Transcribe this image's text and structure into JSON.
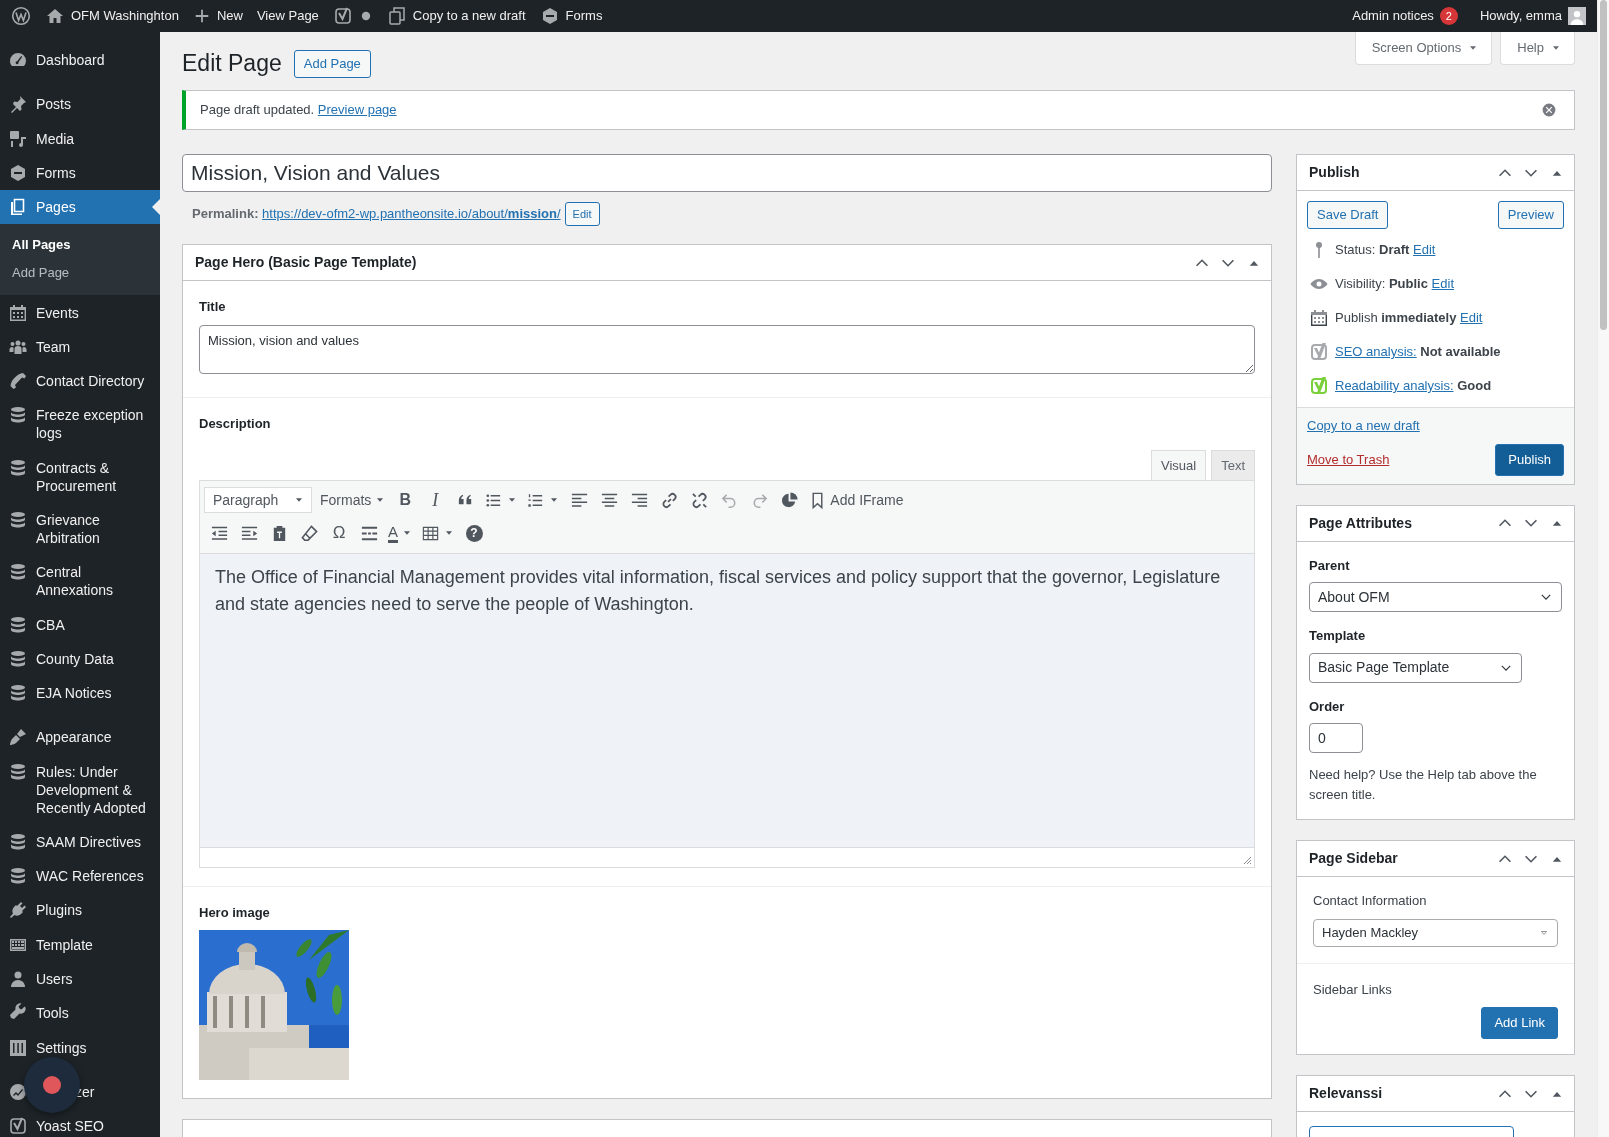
{
  "admin_bar": {
    "site": "OFM Washinghton",
    "new": "New",
    "view": "View Page",
    "copy": "Copy to a new draft",
    "forms": "Forms",
    "notices": "Admin notices",
    "notice_count": "2",
    "greeting": "Howdy, emma"
  },
  "sidebar": {
    "items": [
      {
        "kind": "menu",
        "label": "Dashboard",
        "selected": false
      },
      {
        "kind": "separator"
      },
      {
        "kind": "menu",
        "label": "Posts",
        "selected": false
      },
      {
        "kind": "menu",
        "label": "Media",
        "selected": false
      },
      {
        "kind": "menu",
        "label": "Forms",
        "selected": false
      },
      {
        "kind": "menu",
        "label": "Pages",
        "selected": true,
        "children": [
          {
            "label": "All Pages",
            "selected": true
          },
          {
            "label": "Add Page",
            "selected": false
          }
        ]
      },
      {
        "kind": "menu",
        "label": "Events",
        "selected": false
      },
      {
        "kind": "menu",
        "label": "Team",
        "selected": false
      },
      {
        "kind": "menu",
        "label": "Contact Directory",
        "selected": false
      },
      {
        "kind": "menu",
        "label": "Freeze exception logs",
        "selected": false
      },
      {
        "kind": "menu",
        "label": "Contracts & Procurement",
        "selected": false
      },
      {
        "kind": "menu",
        "label": "Grievance Arbitration",
        "selected": false
      },
      {
        "kind": "menu",
        "label": "Central Annexations",
        "selected": false
      },
      {
        "kind": "menu",
        "label": "CBA",
        "selected": false
      },
      {
        "kind": "menu",
        "label": "County Data",
        "selected": false
      },
      {
        "kind": "menu",
        "label": "EJA Notices",
        "selected": false
      },
      {
        "kind": "separator"
      },
      {
        "kind": "menu",
        "label": "Appearance",
        "selected": false
      },
      {
        "kind": "menu",
        "label": "Rules: Under Development & Recently Adopted",
        "selected": false
      },
      {
        "kind": "menu",
        "label": "SAAM Directives",
        "selected": false
      },
      {
        "kind": "menu",
        "label": "WAC References",
        "selected": false
      },
      {
        "kind": "menu",
        "label": "Plugins",
        "selected": false
      },
      {
        "kind": "menu",
        "label": "Template",
        "selected": false
      },
      {
        "kind": "menu",
        "label": "Users",
        "selected": false
      },
      {
        "kind": "menu",
        "label": "Tools",
        "selected": false
      },
      {
        "kind": "menu",
        "label": "Settings",
        "selected": false
      },
      {
        "kind": "separator"
      },
      {
        "kind": "covered",
        "label": "zer",
        "selected": false
      },
      {
        "kind": "menu",
        "label": "Yoast SEO",
        "selected": false
      }
    ]
  },
  "screen_tabs": [
    "Screen Options",
    "Help"
  ],
  "heading": {
    "title": "Edit Page",
    "button": "Add Page"
  },
  "notice": {
    "text": "Page draft updated.",
    "link": "Preview page"
  },
  "title_field": {
    "value": "Mission, Vision and Values"
  },
  "permalink": {
    "label": "Permalink:",
    "url": "https://dev-ofm2-wp.pantheonsite.io/about/**mission**/",
    "button": "Edit"
  },
  "hero_box": {
    "title": "Page Hero (Basic Page Template)",
    "title_label": "Title",
    "title_value": "Mission, vision and values",
    "description_label": "Description",
    "editor_tabs": [
      {
        "label": "Visual",
        "selected": true
      },
      {
        "label": "Text",
        "selected": false
      }
    ],
    "toolbar": [
      [
        {
          "kind": "select",
          "label": "Paragraph",
          "disabled": false
        },
        {
          "kind": "menu",
          "label": "Formats",
          "disabled": false
        },
        {
          "kind": "glyph",
          "glyph": "B",
          "disabled": false
        },
        {
          "kind": "glyph",
          "glyph": "I",
          "disabled": false
        },
        {
          "kind": "icon",
          "disabled": false
        },
        {
          "kind": "icon_split",
          "disabled": false
        },
        {
          "kind": "icon_split",
          "disabled": false
        },
        {
          "kind": "icon",
          "disabled": false
        },
        {
          "kind": "icon",
          "disabled": false
        },
        {
          "kind": "icon",
          "disabled": false
        },
        {
          "kind": "icon",
          "disabled": false
        },
        {
          "kind": "icon",
          "disabled": false
        },
        {
          "kind": "icon",
          "disabled": true
        },
        {
          "kind": "icon",
          "disabled": true
        },
        {
          "kind": "icon",
          "disabled": false
        },
        {
          "kind": "icon_label",
          "label": "Add IFrame",
          "disabled": false
        }
      ],
      [
        {
          "kind": "icon",
          "disabled": false
        },
        {
          "kind": "icon",
          "disabled": false
        },
        {
          "kind": "icon",
          "disabled": false
        },
        {
          "kind": "icon",
          "disabled": false
        },
        {
          "kind": "glyph",
          "glyph": "Ω",
          "disabled": false
        },
        {
          "kind": "icon",
          "disabled": false
        },
        {
          "kind": "glyph_split",
          "glyph": "A",
          "disabled": false
        },
        {
          "kind": "icon_split",
          "disabled": false
        },
        {
          "kind": "glyph_circle",
          "glyph": "?",
          "disabled": false
        }
      ]
    ],
    "content": "The Office of Financial Management provides vital information, fiscal services and policy support that the governor, Legislature and state agencies need to serve the people of Washington.",
    "image_label": "Hero image"
  },
  "publish_box": {
    "title": "Publish",
    "save_draft": "Save Draft",
    "preview": "Preview",
    "meta": [
      {
        "label": "Status:",
        "value": "Draft",
        "link": "Edit"
      },
      {
        "label": "Visibility:",
        "value": "Public",
        "link": "Edit"
      },
      {
        "label": "Publish",
        "value": "immediately",
        "link": "Edit"
      }
    ],
    "analysis": [
      {
        "link": "SEO analysis:",
        "value": "Not available",
        "color": "#a7aaad"
      },
      {
        "link": "Readability analysis:",
        "value": "Good",
        "color": "#7ad03a"
      }
    ],
    "copy_link": "Copy to a new draft",
    "trash_link": "Move to Trash",
    "publish": "Publish"
  },
  "attributes_box": {
    "title": "Page Attributes",
    "parent_label": "Parent",
    "parent": "About OFM",
    "template_label": "Template",
    "template": "Basic Page Template",
    "order_label": "Order",
    "order": "0",
    "help": "Need help? Use the Help tab above the screen title."
  },
  "sidebar_box": {
    "title": "Page Sidebar",
    "contact_label": "Contact Information",
    "contact": "Hayden Mackley",
    "links_label": "Sidebar Links",
    "add_link": "Add Link"
  },
  "relevanssi_box": {
    "title": "Relevanssi"
  }
}
